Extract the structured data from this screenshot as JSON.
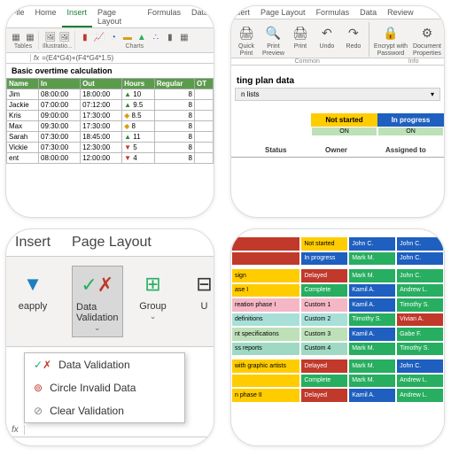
{
  "card1": {
    "tabs": [
      "File",
      "Home",
      "Insert",
      "Page Layout",
      "Formulas",
      "Data"
    ],
    "active_tab": "Insert",
    "groups": [
      "Tables",
      "Illustratio...",
      "Charts"
    ],
    "formula_cell": "",
    "fx_label": "fx",
    "formula": "=(E4*G4)+(F4*G4*1.5)",
    "title": "Basic overtime calculation",
    "headers": [
      "Name",
      "In",
      "Out",
      "Hours",
      "Regular",
      "OT"
    ],
    "rows": [
      {
        "name": "Jim",
        "in": "08:00:00",
        "out": "18:00:00",
        "dir": "up",
        "hours": "10",
        "regular": "8"
      },
      {
        "name": "Jackie",
        "in": "07:00:00",
        "out": "07:12:00",
        "dir": "up",
        "hours": "9.5",
        "regular": "8"
      },
      {
        "name": "Kris",
        "in": "09:00:00",
        "out": "17:30:00",
        "dir": "mid",
        "hours": "8.5",
        "regular": "8"
      },
      {
        "name": "Max",
        "in": "09:30:00",
        "out": "17:30:00",
        "dir": "mid",
        "hours": "8",
        "regular": "8"
      },
      {
        "name": "Sarah",
        "in": "07:30:00",
        "out": "18:45:00",
        "dir": "up",
        "hours": "11",
        "regular": "8"
      },
      {
        "name": "Vickie",
        "in": "07:30:00",
        "out": "12:30:00",
        "dir": "dn",
        "hours": "5",
        "regular": "8"
      },
      {
        "name": "ent",
        "in": "08:00:00",
        "out": "12:00:00",
        "dir": "dn",
        "hours": "4",
        "regular": "8"
      }
    ]
  },
  "card2": {
    "tabs": [
      "sert",
      "Page Layout",
      "Formulas",
      "Data",
      "Review"
    ],
    "buttons": [
      {
        "label": "Quick\nPrint"
      },
      {
        "label": "Print\nPreview"
      },
      {
        "label": "Print"
      },
      {
        "label": "Undo"
      },
      {
        "label": "Redo"
      },
      {
        "label": "Encrypt with\nPassword"
      },
      {
        "label": "Document\nProperties"
      }
    ],
    "group_labels": [
      "Common",
      "Info"
    ],
    "plan_title": "ting plan data",
    "lists_label": "n lists",
    "status_headers": [
      "Not started",
      "In progress"
    ],
    "on": "ON",
    "col_headers": [
      "Status",
      "Owner",
      "Assigned to"
    ]
  },
  "card3": {
    "tabs": [
      "Insert",
      "Page Layout"
    ],
    "buttons": {
      "reapply": "eapply",
      "validation": "Data Validation",
      "group": "Group",
      "u": "U"
    },
    "menu": [
      "Data Validation",
      "Circle Invalid Data",
      "Clear Validation"
    ],
    "fx": "fx"
  },
  "card4": {
    "rows": [
      {
        "cls": [
          "c-red",
          "c-yellow",
          "c-blue",
          "c-blue"
        ],
        "cells": [
          "",
          "Not started",
          "John C.",
          "John C."
        ]
      },
      {
        "cls": [
          "c-red",
          "c-blue",
          "c-green",
          "c-blue"
        ],
        "cells": [
          "",
          "In progress",
          "Mark M.",
          "John C."
        ]
      },
      {
        "sep": true
      },
      {
        "cls": [
          "c-yellow",
          "c-red",
          "c-green",
          "c-green"
        ],
        "cells": [
          "sign",
          "Delayed",
          "Mark M.",
          "John C."
        ]
      },
      {
        "cls": [
          "c-yellow",
          "c-green",
          "c-blue",
          "c-green"
        ],
        "cells": [
          "ase I",
          "Complete",
          "Kamil A.",
          "Andrew L."
        ]
      },
      {
        "cls": [
          "c-pink",
          "c-pink",
          "c-blue",
          "c-green"
        ],
        "cells": [
          "reation phase I",
          "Custom 1",
          "Kamil A.",
          "Timothy S."
        ]
      },
      {
        "cls": [
          "c-cyan",
          "c-cyan",
          "c-green",
          "c-red"
        ],
        "cells": [
          "definitions",
          "Custom 2",
          "Timothy S.",
          "Vivian A."
        ]
      },
      {
        "cls": [
          "c-lgrn",
          "c-lgrn",
          "c-blue",
          "c-green"
        ],
        "cells": [
          "nt specifications",
          "Custom 3",
          "Kamil A.",
          "Gabe F."
        ]
      },
      {
        "cls": [
          "c-mint",
          "c-mint",
          "c-green",
          "c-green"
        ],
        "cells": [
          "ss reports",
          "Custom 4",
          "Mark M.",
          "Timothy S."
        ]
      },
      {
        "sep": true
      },
      {
        "cls": [
          "c-yellow",
          "c-red",
          "c-green",
          "c-blue"
        ],
        "cells": [
          "with graphic artists",
          "Delayed",
          "Mark M.",
          "John C."
        ]
      },
      {
        "cls": [
          "c-yellow",
          "c-green",
          "c-green",
          "c-green"
        ],
        "cells": [
          "",
          "Complete",
          "Mark M.",
          "Andrew L."
        ]
      },
      {
        "cls": [
          "c-yellow",
          "c-red",
          "c-blue",
          "c-green"
        ],
        "cells": [
          "n phase II",
          "Delayed",
          "Kamil A.",
          "Andrew L."
        ]
      }
    ]
  }
}
